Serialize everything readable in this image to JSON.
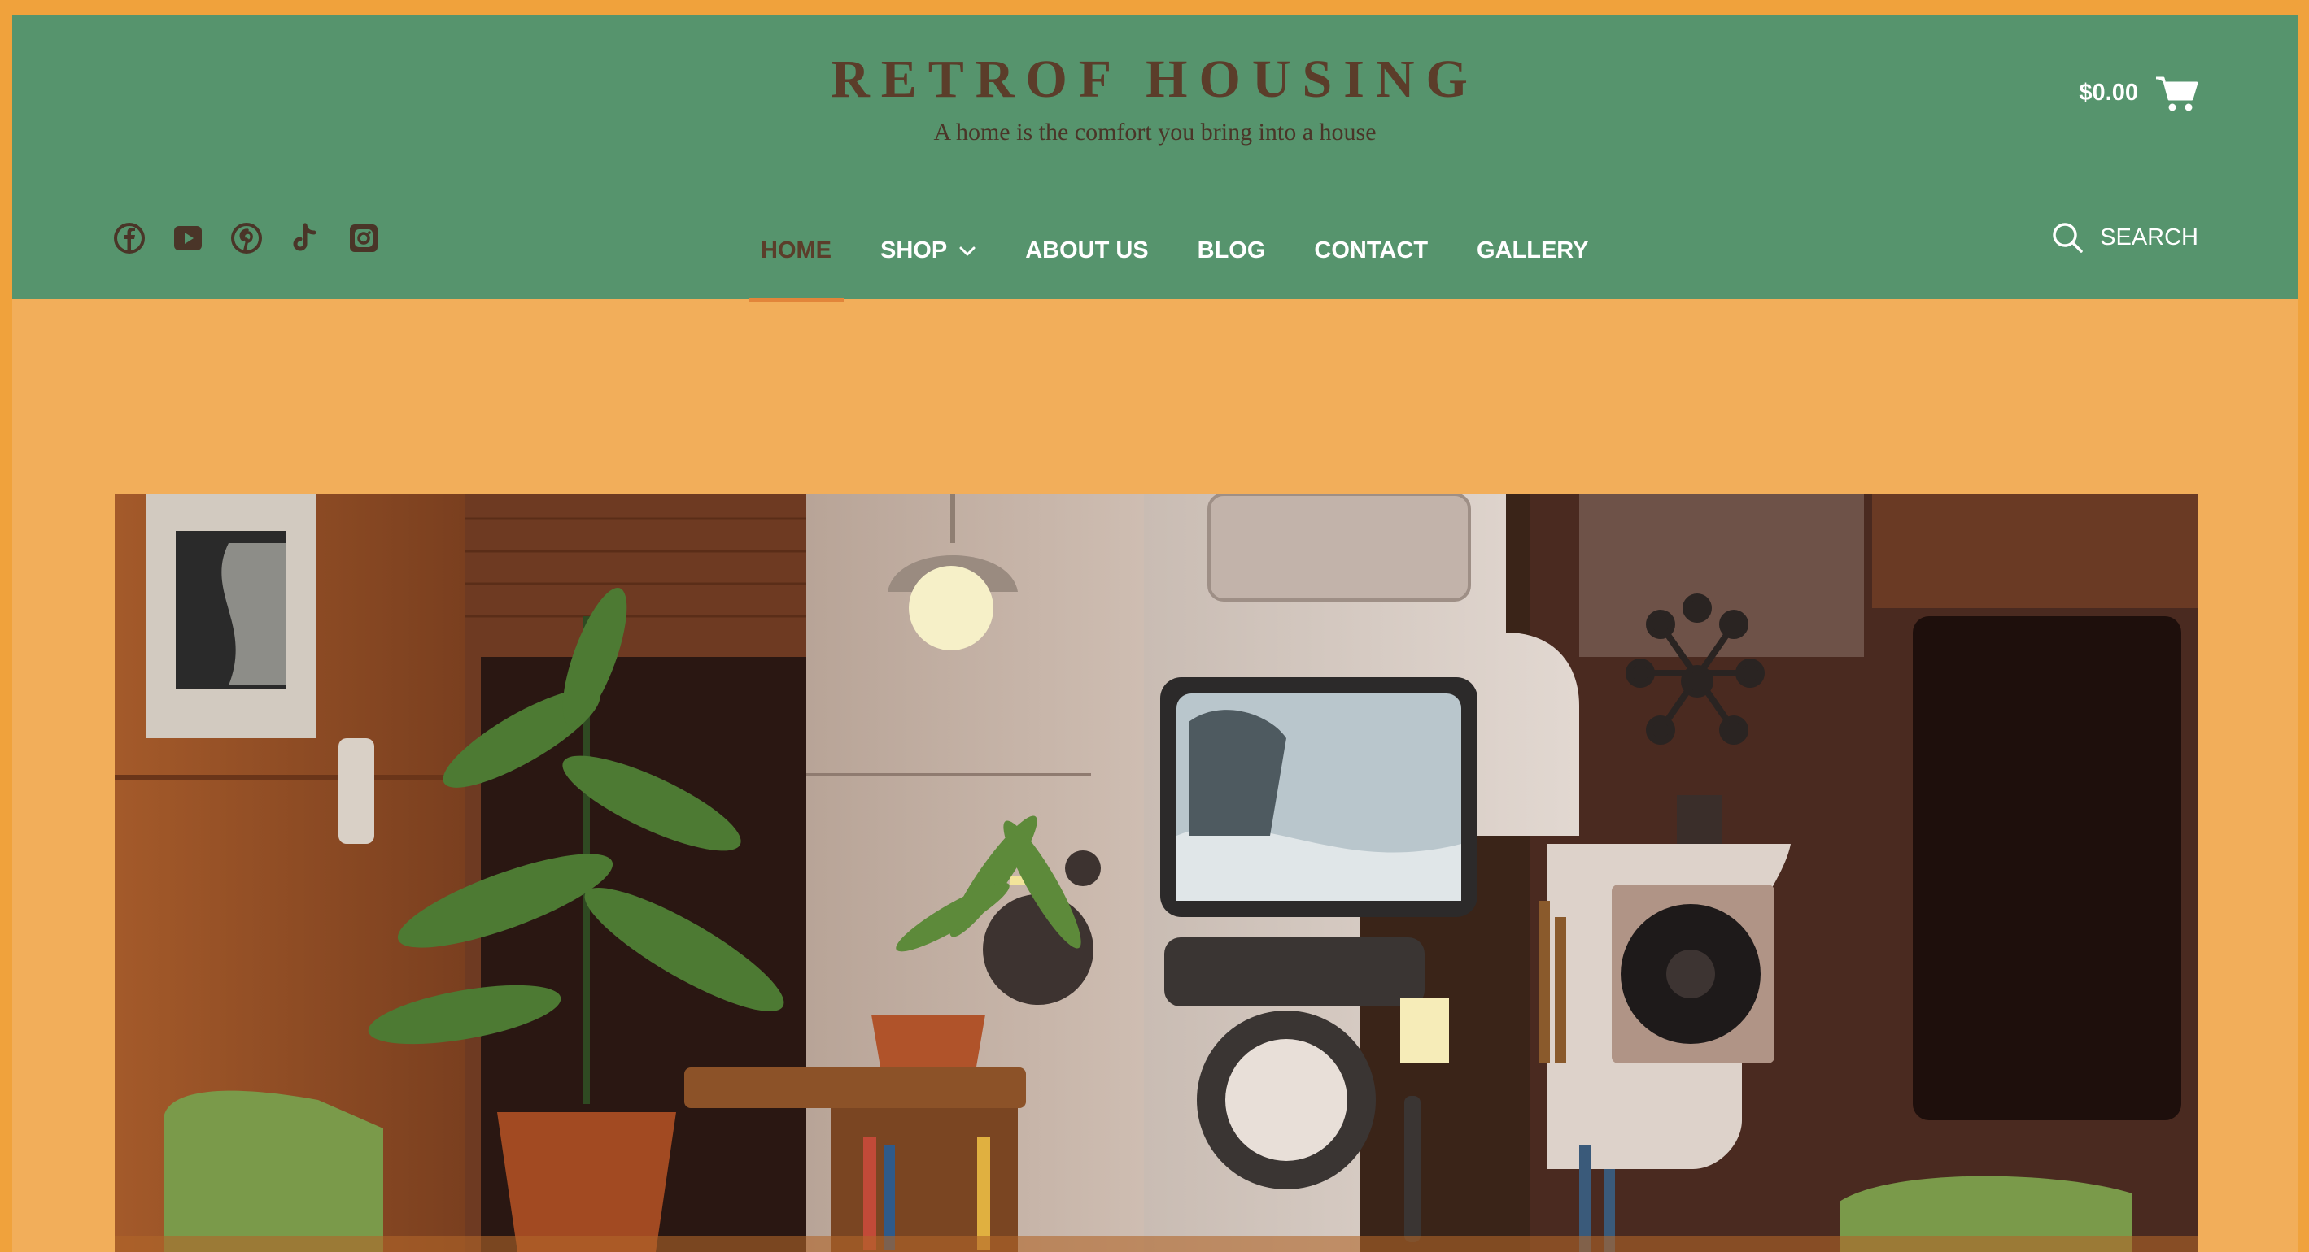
{
  "site": {
    "title": "RETROF HOUSING",
    "tagline": "A home is the comfort you bring into a house"
  },
  "cart": {
    "total": "$0.00",
    "icon": "cart-icon"
  },
  "social": [
    {
      "name": "facebook-icon"
    },
    {
      "name": "youtube-icon"
    },
    {
      "name": "pinterest-icon"
    },
    {
      "name": "tiktok-icon"
    },
    {
      "name": "instagram-icon"
    }
  ],
  "nav": {
    "items": [
      {
        "label": "HOME",
        "active": true
      },
      {
        "label": "SHOP",
        "has_dropdown": true
      },
      {
        "label": "ABOUT US"
      },
      {
        "label": "BLOG"
      },
      {
        "label": "CONTACT"
      },
      {
        "label": "GALLERY"
      }
    ]
  },
  "search": {
    "label": "SEARCH",
    "icon": "search-icon"
  },
  "colors": {
    "frame": "#f0a23c",
    "page_background": "#f2ae5a",
    "header": "#56946d",
    "title": "#5b3d2a",
    "active_underline": "#e2853a"
  }
}
